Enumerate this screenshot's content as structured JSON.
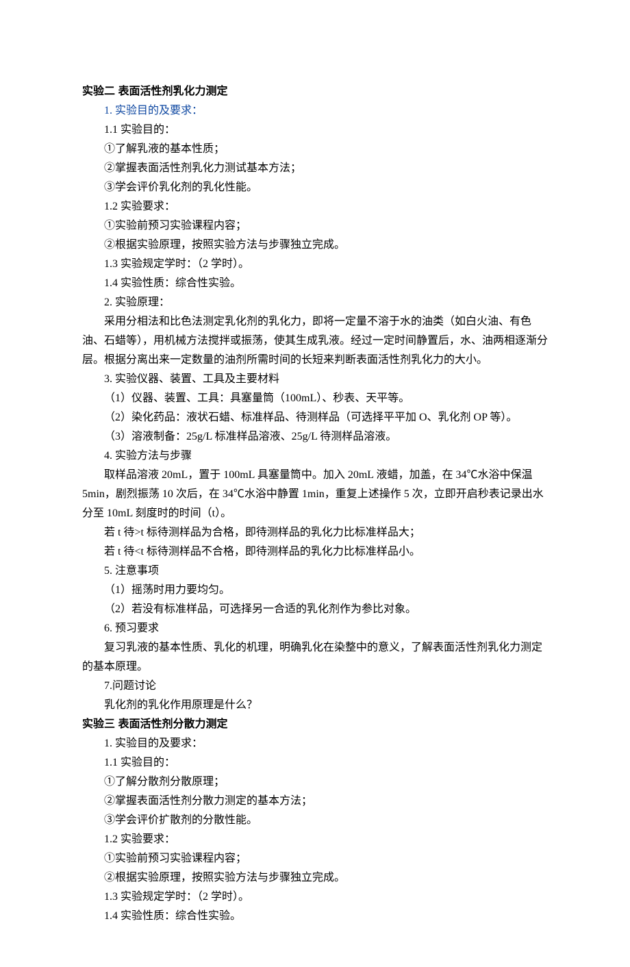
{
  "exp2": {
    "title": "实验二    表面活性剂乳化力测定",
    "s1": "1. 实验目的及要求：",
    "s1_1": "1.1 实验目的：",
    "a1": "①了解乳液的基本性质；",
    "a2": "②掌握表面活性剂乳化力测试基本方法；",
    "a3": "③学会评价乳化剂的乳化性能。",
    "s1_2": "1.2 实验要求：",
    "b1": "①实验前预习实验课程内容；",
    "b2": "②根据实验原理，按照实验方法与步骤独立完成。",
    "s1_3": "1.3 实验规定学时：（2 学时）。",
    "s1_4": "1.4 实验性质：综合性实验。",
    "s2": "2. 实验原理：",
    "s2_p": "采用分相法和比色法测定乳化剂的乳化力，即将一定量不溶于水的油类（如白火油、有色油、石蜡等），用机械方法搅拌或振荡，使其生成乳液。经过一定时间静置后，水、油两相逐渐分层。根据分离出来一定数量的油剂所需时间的长短来判断表面活性剂乳化力的大小。",
    "s3": "3. 实验仪器、装置、工具及主要材料",
    "s3_1": "（1）仪器、装置、工具：具塞量筒（100mL）、秒表、天平等。",
    "s3_2": "（2）染化药品：液状石蜡、标准样品、待测样品（可选择平平加 O、乳化剂 OP 等）。",
    "s3_3": "（3）溶液制备：25g/L 标准样品溶液、25g/L 待测样品溶液。",
    "s4": "4. 实验方法与步骤",
    "s4_p": "取样品溶液 20mL，置于 100mL 具塞量筒中。加入 20mL 液蜡，加盖，在 34℃水浴中保温5min，剧烈振荡 10 次后，在 34℃水浴中静置 1min，重复上述操作 5 次，立即开启秒表记录出水分至 10mL 刻度时的时间（t）。",
    "s4_r1": "若 t 待>t 标待测样品为合格，即待测样品的乳化力比标准样品大；",
    "s4_r2": "若 t 待<t 标待测样品不合格，即待测样品的乳化力比标准样品小。",
    "s5": "5. 注意事项",
    "s5_1": "（1）摇荡时用力要均匀。",
    "s5_2": "（2）若没有标准样品，可选择另一合适的乳化剂作为参比对象。",
    "s6": "6. 预习要求",
    "s6_p": "复习乳液的基本性质、乳化的机理，明确乳化在染整中的意义，了解表面活性剂乳化力测定的基本原理。",
    "s7": "7.问题讨论",
    "s7_q": "乳化剂的乳化作用原理是什么？"
  },
  "exp3": {
    "title": "实验三  表面活性剂分散力测定",
    "s1": "1. 实验目的及要求：",
    "s1_1": "1.1 实验目的：",
    "a1": "①了解分散剂分散原理；",
    "a2": "②掌握表面活性剂分散力测定的基本方法；",
    "a3": "③学会评价扩散剂的分散性能。",
    "s1_2": "1.2 实验要求：",
    "b1": "①实验前预习实验课程内容；",
    "b2": "②根据实验原理，按照实验方法与步骤独立完成。",
    "s1_3": "1.3 实验规定学时：（2 学时）。",
    "s1_4": "1.4 实验性质：综合性实验。"
  }
}
